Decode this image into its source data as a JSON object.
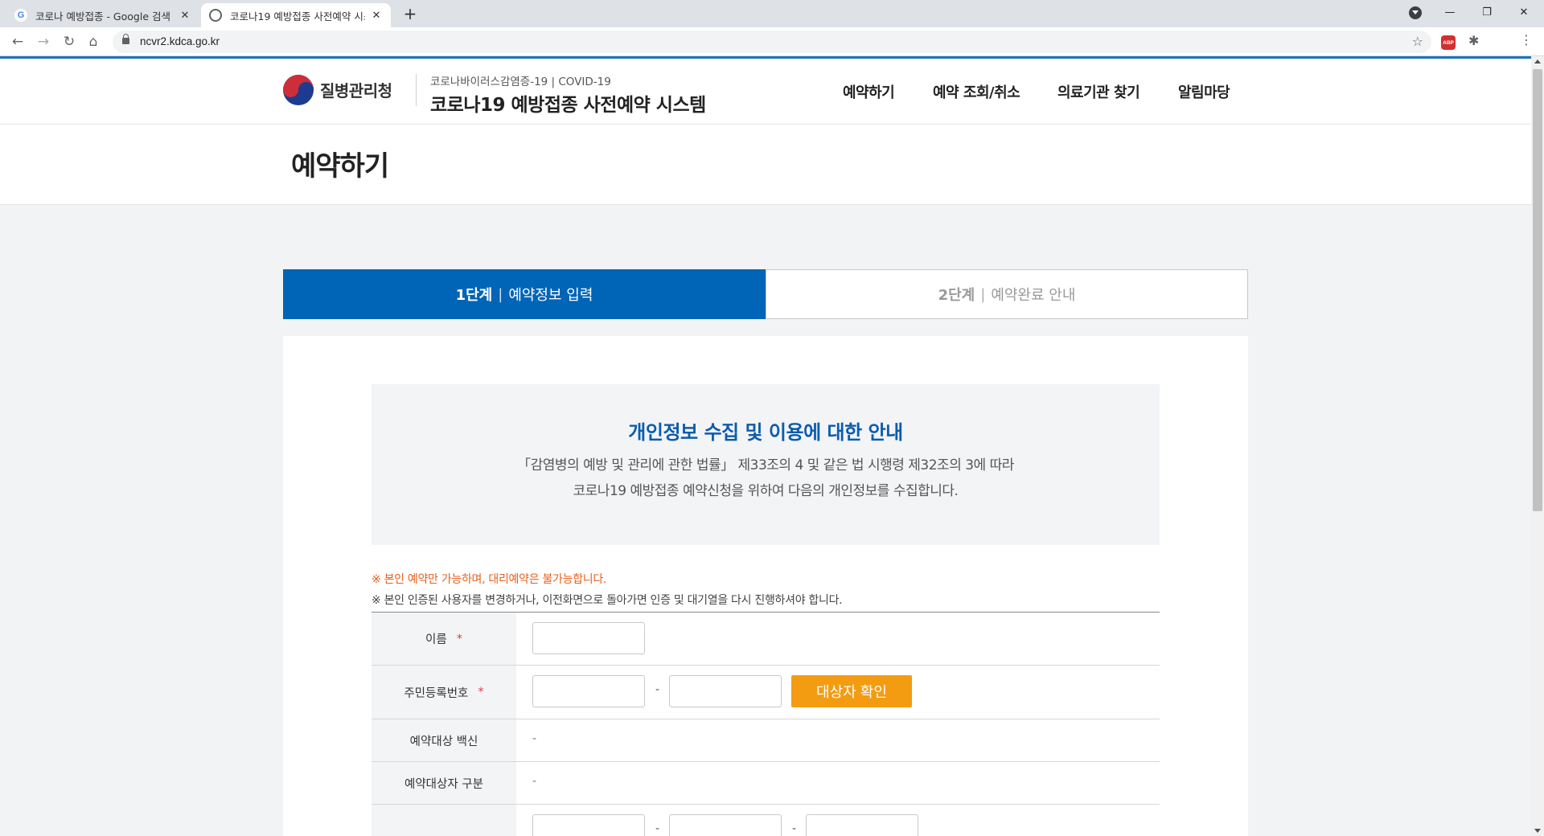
{
  "browser": {
    "tabs": [
      {
        "favicon": "G",
        "title": "코로나 예방접종 - Google 검색",
        "close": "✕"
      },
      {
        "favicon": "",
        "title": "코로나19 예방접종 사전예약 시스템",
        "close": "✕"
      }
    ],
    "new_tab": "+",
    "window_controls": {
      "minimize": "—",
      "restore": "❐",
      "close": "✕"
    },
    "nav": {
      "back": "←",
      "forward": "→",
      "reload": "↻",
      "home": "⌂"
    },
    "url": "ncvr2.kdca.go.kr",
    "bookmark_star": "☆",
    "extensions": {
      "abp": "ABP",
      "puzzle": "✱"
    },
    "menu": "⋮"
  },
  "header": {
    "org_name": "질병관리청",
    "system_subtitle": "코로나바이러스감염증-19 | COVID-19",
    "system_title": "코로나19 예방접종 사전예약 시스템",
    "nav": [
      "예약하기",
      "예약 조회/취소",
      "의료기관 찾기",
      "알림마당"
    ]
  },
  "page": {
    "title": "예약하기"
  },
  "steps": [
    {
      "num": "1단계",
      "sep": "|",
      "label": "예약정보 입력",
      "active": true
    },
    {
      "num": "2단계",
      "sep": "|",
      "label": "예약완료 안내",
      "active": false
    }
  ],
  "notice": {
    "title": "개인정보 수집 및 이용에 대한 안내",
    "line1": "「감염병의 예방 및 관리에 관한 법률」 제33조의 4 및 같은 법 시행령 제32조의 3에 따라",
    "line2": "코로나19 예방접종 예약신청을 위하여 다음의 개인정보를 수집합니다."
  },
  "warnings": {
    "red": "※ 본인 예약만 가능하며, 대리예약은 불가능합니다.",
    "gray": "※ 본인 인증된 사용자를 변경하거나, 이전화면으로 돌아가면 인증 및 대기열을 다시 진행하셔야 합니다."
  },
  "form": {
    "name_label": "이름",
    "rrn_label": "주민등록번호",
    "required_mark": "*",
    "dash": "-",
    "verify_button": "대상자 확인",
    "vaccine_label": "예약대상 백신",
    "vaccine_value": "-",
    "category_label": "예약대상자 구분",
    "category_value": "-"
  },
  "colors": {
    "brand_blue": "#0064b7",
    "notice_title": "#0b5cad",
    "warning_orange": "#e85f1c",
    "button_orange": "#f39c12",
    "required_red": "#e53935"
  }
}
